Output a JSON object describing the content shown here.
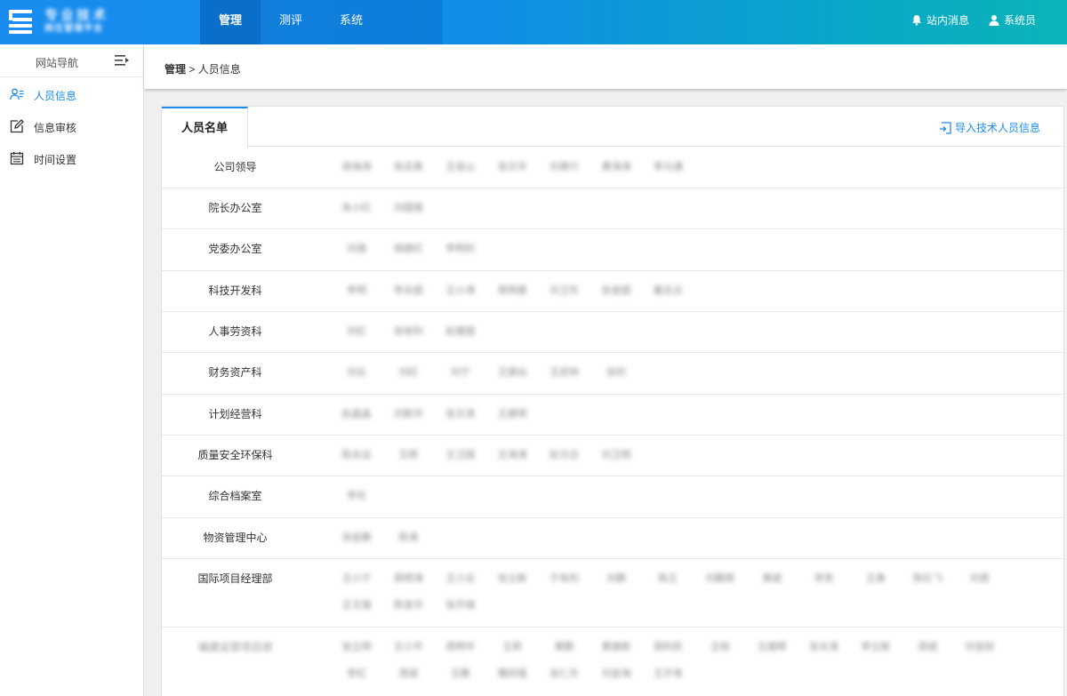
{
  "header": {
    "logo_line1": "专业技术",
    "logo_line2": "岗位管理平台",
    "nav": [
      {
        "label": "管理",
        "active": true
      },
      {
        "label": "测评",
        "active": false
      },
      {
        "label": "系统",
        "active": false
      }
    ],
    "messages_label": "站内消息",
    "user_label": "系统员"
  },
  "sidebar": {
    "title": "网站导航",
    "items": [
      {
        "label": "人员信息",
        "icon": "user-list-icon",
        "active": true
      },
      {
        "label": "信息审核",
        "icon": "edit-icon",
        "active": false
      },
      {
        "label": "时间设置",
        "icon": "calendar-icon",
        "active": false
      }
    ]
  },
  "breadcrumb": {
    "root": "管理",
    "sep": ">",
    "current": "人员信息"
  },
  "panel": {
    "tab_label": "人员名单",
    "import_label": "导入技术人员信息"
  },
  "departments": [
    {
      "name": "公司领导",
      "people": [
        "胡海涛",
        "张志勇",
        "王金山",
        "张文华",
        "刘勇行",
        "黄海涛",
        "李元通"
      ]
    },
    {
      "name": "院长办公室",
      "people": [
        "朱小红",
        "刘国强"
      ]
    },
    {
      "name": "党委办公室",
      "people": [
        "刘强",
        "胡建红",
        "李明利"
      ]
    },
    {
      "name": "科技开发科",
      "people": [
        "李明",
        "李永超",
        "王小涛",
        "周明建",
        "刘卫东",
        "张金国",
        "戴志云"
      ]
    },
    {
      "name": "人事劳资科",
      "people": [
        "刘红",
        "张有利",
        "赵建国"
      ]
    },
    {
      "name": "财务资产科",
      "people": [
        "刘云",
        "刘红",
        "刘宁",
        "王建仙",
        "王武林",
        "张利"
      ]
    },
    {
      "name": "计划经营科",
      "people": [
        "赵晶晶",
        "刘斯华",
        "张文清",
        "王建明"
      ]
    },
    {
      "name": "质量安全环保科",
      "people": [
        "陈永远",
        "王辉",
        "王卫国",
        "王海涛",
        "赵文达",
        "刘卫明"
      ]
    },
    {
      "name": "综合档案室",
      "people": [
        "李欢"
      ]
    },
    {
      "name": "物资管理中心",
      "people": [
        "张金鹏",
        "陈清"
      ]
    },
    {
      "name": "国际项目经理部",
      "people": [
        "王小宁",
        "周明涛",
        "王小云",
        "张立新",
        "于有利",
        "刘鹏",
        "陈正",
        "刘鹏辉",
        "黄斌",
        "李笑",
        "王勇",
        "陈红飞",
        "刘君",
        "王文强",
        "陈金华",
        "张开瑞"
      ]
    },
    {
      "name": "福建运营项目部",
      "people": [
        "张立明",
        "王小平",
        "周明华",
        "王莉",
        "黄鹏",
        "黄建新",
        "周利民",
        "王柏",
        "王建辉",
        "张水清",
        "李立新",
        "周斌",
        "刘宝财",
        "李红",
        "周斌",
        "王鹏",
        "魏欣强",
        "张仁东",
        "刘金海",
        "王开来"
      ]
    }
  ],
  "colors": {
    "accent": "#1a8cf0",
    "topbar_end": "#0bb3b8"
  }
}
